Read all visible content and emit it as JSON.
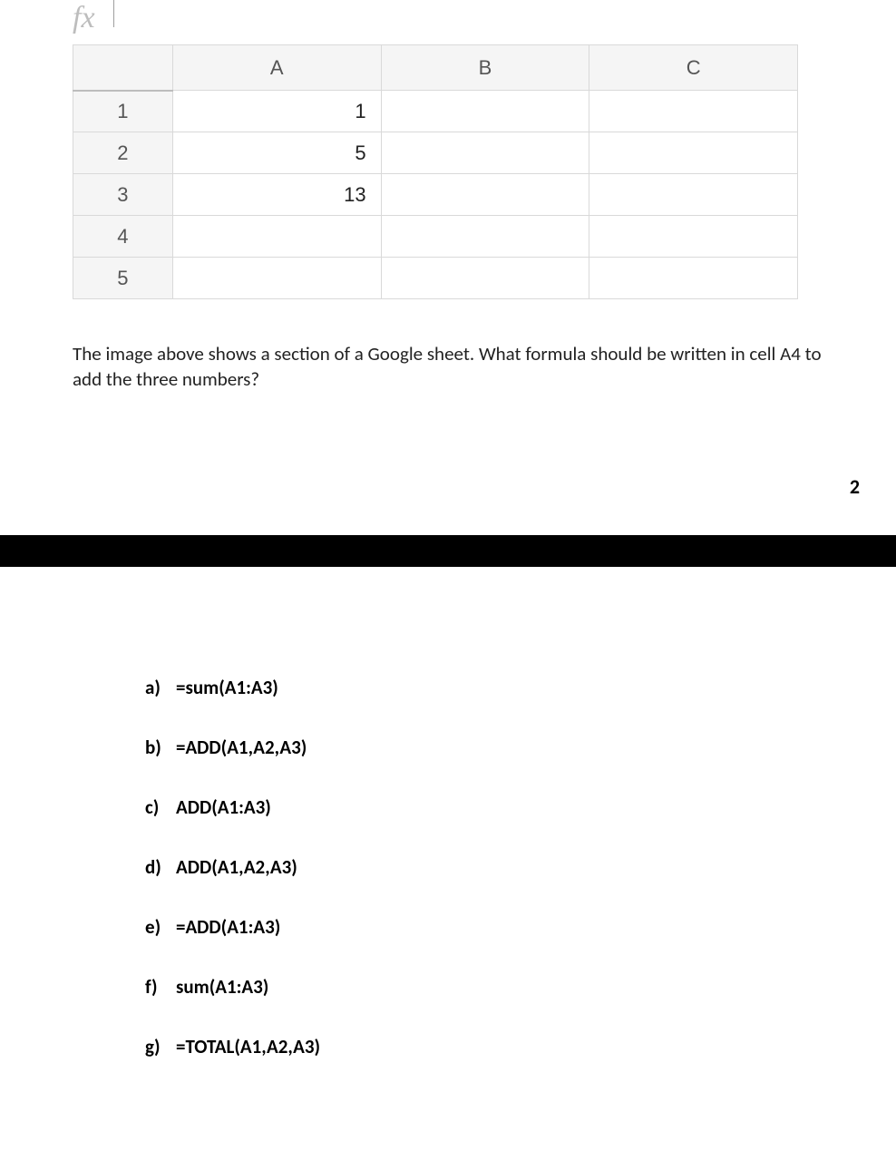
{
  "formula_bar": {
    "fx_label": "fx"
  },
  "spreadsheet": {
    "column_headers": [
      "A",
      "B",
      "C"
    ],
    "row_headers": [
      "1",
      "2",
      "3",
      "4",
      "5"
    ],
    "cells": {
      "A1": "1",
      "A2": "5",
      "A3": "13",
      "A4": "",
      "A5": "",
      "B1": "",
      "B2": "",
      "B3": "",
      "B4": "",
      "B5": "",
      "C1": "",
      "C2": "",
      "C3": "",
      "C4": "",
      "C5": ""
    }
  },
  "question": {
    "text": "The image above shows a section of a Google sheet.  What formula should be written in cell A4 to add the three numbers?"
  },
  "page_number": "2",
  "answers": [
    {
      "letter": "a)",
      "text": "=sum(A1:A3)"
    },
    {
      "letter": "b)",
      "text": "=ADD(A1,A2,A3)"
    },
    {
      "letter": "c)",
      "text": "ADD(A1:A3)"
    },
    {
      "letter": "d)",
      "text": "ADD(A1,A2,A3)"
    },
    {
      "letter": "e)",
      "text": "=ADD(A1:A3)"
    },
    {
      "letter": "f)",
      "text": "sum(A1:A3)"
    },
    {
      "letter": "g)",
      "text": "=TOTAL(A1,A2,A3)"
    }
  ]
}
